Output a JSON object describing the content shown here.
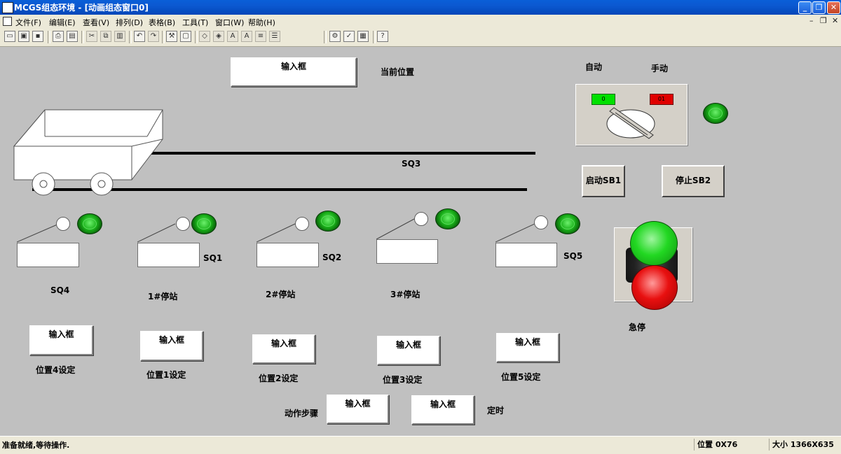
{
  "window": {
    "title": "MCGS组态环境 - [动画组态窗口0]"
  },
  "menu": [
    "文件(F)",
    "编辑(E)",
    "查看(V)",
    "排列(D)",
    "表格(B)",
    "工具(T)",
    "窗口(W)",
    "帮助(H)"
  ],
  "toolbar_icons": [
    "new-window-icon",
    "open-icon",
    "save-icon",
    "print-icon",
    "print-preview-icon",
    "cut-icon",
    "copy-icon",
    "paste-icon",
    "undo-icon",
    "redo-icon",
    "tools-icon",
    "frame-icon",
    "align-icon-1",
    "align-icon-2",
    "font-icon",
    "align-icon-3",
    "align-icon-4",
    "properties-icon",
    "check-icon",
    "data-icon",
    "help-icon"
  ],
  "canvas": {
    "current_position": {
      "input": "输入框",
      "label": "当前位置"
    },
    "mode": {
      "auto": "自动",
      "manual": "手动",
      "left_indicator": "0",
      "right_indicator": "01"
    },
    "rail_label": "SQ3",
    "buttons": {
      "start": "启动SB1",
      "stop": "停止SB2"
    },
    "estop_label": "急停",
    "stations": [
      {
        "sensor": "SQ4",
        "name": "",
        "input": "输入框",
        "setting": "位置4设定"
      },
      {
        "sensor": "SQ1",
        "name": "1#停站",
        "input": "输入框",
        "setting": "位置1设定"
      },
      {
        "sensor": "SQ2",
        "name": "2#停站",
        "input": "输入框",
        "setting": "位置2设定"
      },
      {
        "sensor": "",
        "name": "3#停站",
        "input": "输入框",
        "setting": "位置3设定"
      },
      {
        "sensor": "SQ5",
        "name": "",
        "input": "输入框",
        "setting": "位置5设定"
      }
    ],
    "action": {
      "label": "动作步骤",
      "step_input": "输入框",
      "timer_input": "输入框",
      "timer_label": "定时"
    }
  },
  "status": {
    "message": "准备就绪,等待操作.",
    "position": "位置 0X76",
    "size": "大小 1366X635"
  },
  "colors": {
    "lamp": "#19b019",
    "indicator_green": "#00e000",
    "indicator_red": "#e00000",
    "estop_red": "#e81010",
    "start_green": "#22d822"
  }
}
